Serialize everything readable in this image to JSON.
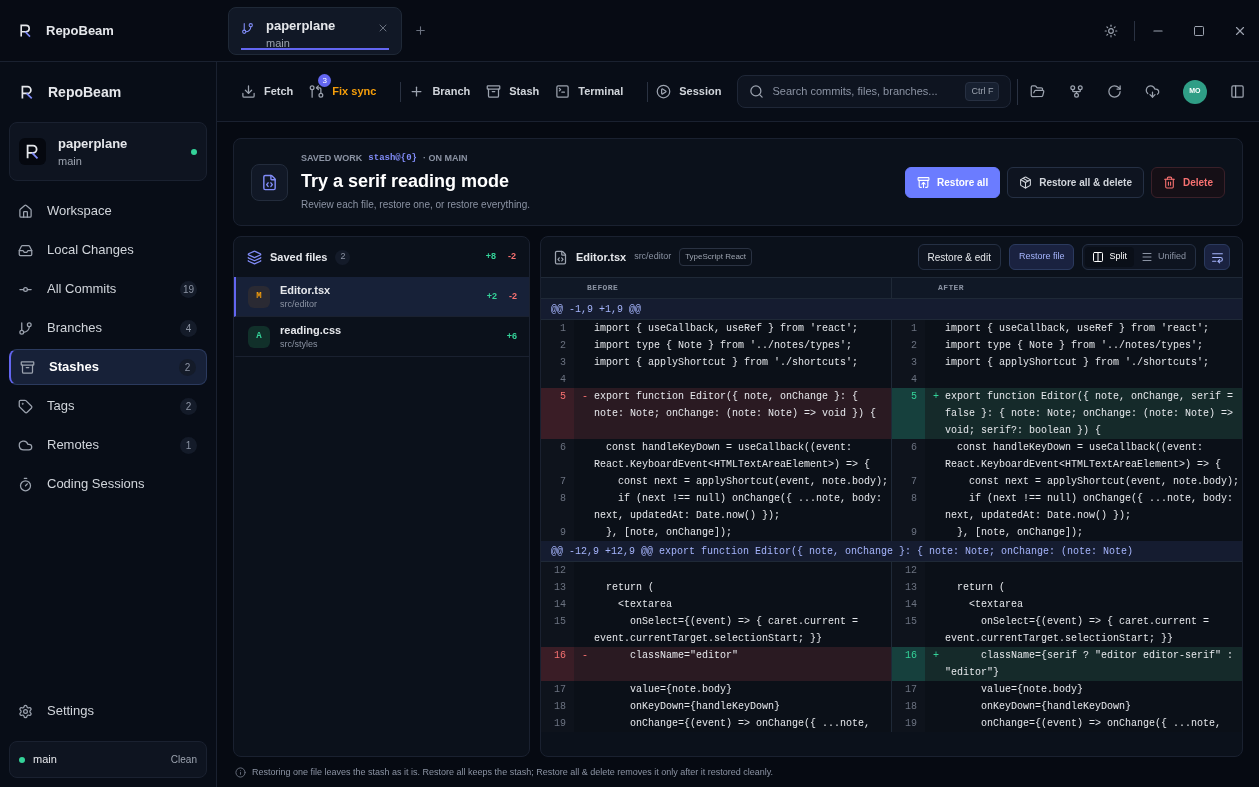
{
  "app": {
    "name": "RepoBeam"
  },
  "tabs": [
    {
      "title": "paperplane",
      "subtitle": "main",
      "selected": true
    }
  ],
  "sidebar": {
    "brand": "RepoBeam",
    "repo": {
      "name": "paperplane",
      "branch": "main",
      "online": true
    },
    "items": [
      {
        "label": "Workspace",
        "selected": false
      },
      {
        "label": "Local Changes",
        "selected": false
      },
      {
        "label": "All Commits",
        "count": "19",
        "selected": false
      },
      {
        "label": "Branches",
        "count": "4",
        "selected": false
      },
      {
        "label": "Stashes",
        "count": "2",
        "selected": true
      },
      {
        "label": "Tags",
        "count": "2",
        "selected": false
      },
      {
        "label": "Remotes",
        "count": "1",
        "selected": false
      },
      {
        "label": "Coding Sessions",
        "selected": false
      }
    ],
    "settings": "Settings",
    "status": {
      "branch": "main",
      "state": "Clean"
    }
  },
  "toolbar": {
    "actions": [
      {
        "kind": "fetch",
        "label": "Fetch",
        "warning": false
      },
      {
        "kind": "sync",
        "label": "Fix sync",
        "badge": "3",
        "warning": true
      },
      {
        "kind": "divider"
      },
      {
        "kind": "branch",
        "label": "Branch",
        "warning": false
      },
      {
        "kind": "stash",
        "label": "Stash",
        "warning": false
      },
      {
        "kind": "terminal",
        "label": "Terminal",
        "warning": false
      },
      {
        "kind": "divider"
      },
      {
        "kind": "session",
        "label": "Session",
        "warning": false
      }
    ],
    "search": {
      "placeholder": "Search commits, files, branches...",
      "shortcut": "Ctrl F"
    },
    "avatar": "MO"
  },
  "stash": {
    "eyebrow": "SAVED WORK",
    "ref": "stash@{0}",
    "on": "· ON MAIN",
    "title": "Try a serif reading mode",
    "subtitle": "Review each file, restore one, or restore everything.",
    "buttons": [
      {
        "kind": "primary",
        "label": "Restore all"
      },
      {
        "kind": "secondary",
        "label": "Restore all & delete"
      },
      {
        "kind": "danger",
        "label": "Delete"
      }
    ]
  },
  "files": {
    "title": "Saved files",
    "count": "2",
    "added": "+8",
    "removed": "-2",
    "items": [
      {
        "status": "M",
        "name": "Editor.tsx",
        "path": "src/editor",
        "added": "+2",
        "removed": "-2",
        "selected": true
      },
      {
        "status": "A",
        "name": "reading.css",
        "path": "src/styles",
        "added": "+6",
        "selected": false
      }
    ]
  },
  "diff": {
    "file": "Editor.tsx",
    "path": "src/editor",
    "language": "TypeScript React",
    "restore_edit": "Restore & edit",
    "restore_file": "Restore file",
    "views": [
      {
        "label": "Split",
        "selected": true
      },
      {
        "label": "Unified",
        "selected": false
      }
    ],
    "before": "BEFORE",
    "after": "AFTER",
    "hunks": [
      {
        "header": "@@ -1,9 +1,9 @@",
        "rows": [
          {
            "left": {
              "n": "1",
              "text": "import { useCallback, useRef } from 'react';"
            },
            "right": {
              "n": "1",
              "text": "import { useCallback, useRef } from 'react';"
            }
          },
          {
            "left": {
              "n": "2",
              "text": "import type { Note } from '../notes/types';"
            },
            "right": {
              "n": "2",
              "text": "import type { Note } from '../notes/types';"
            }
          },
          {
            "left": {
              "n": "3",
              "text": "import { applyShortcut } from './shortcuts';"
            },
            "right": {
              "n": "3",
              "text": "import { applyShortcut } from './shortcuts';"
            }
          },
          {
            "left": {
              "n": "4"
            },
            "right": {
              "n": "4"
            }
          },
          {
            "left": {
              "n": "5",
              "kind": "del",
              "sign": "-",
              "text": "export function Editor({ note, onChange }: { note: Note; onChange: (note: Note) => void }) {"
            },
            "right": {
              "n": "5",
              "kind": "add",
              "sign": "+",
              "text": "export function Editor({ note, onChange, serif = false }: { note: Note; onChange: (note: Note) => void; serif?: boolean }) {"
            }
          },
          {
            "left": {
              "n": "6",
              "text": "  const handleKeyDown = useCallback((event: React.KeyboardEvent<HTMLTextAreaElement>) => {"
            },
            "right": {
              "n": "6",
              "text": "  const handleKeyDown = useCallback((event: React.KeyboardEvent<HTMLTextAreaElement>) => {"
            }
          },
          {
            "left": {
              "n": "7",
              "text": "    const next = applyShortcut(event, note.body);"
            },
            "right": {
              "n": "7",
              "text": "    const next = applyShortcut(event, note.body);"
            }
          },
          {
            "left": {
              "n": "8",
              "text": "    if (next !== null) onChange({ ...note, body: next, updatedAt: Date.now() });"
            },
            "right": {
              "n": "8",
              "text": "    if (next !== null) onChange({ ...note, body: next, updatedAt: Date.now() });"
            }
          },
          {
            "left": {
              "n": "9",
              "text": "  }, [note, onChange]);"
            },
            "right": {
              "n": "9",
              "text": "  }, [note, onChange]);"
            }
          }
        ]
      },
      {
        "header": "@@ -12,9 +12,9 @@ export function Editor({ note, onChange }: { note: Note; onChange: (note: Note)",
        "rows": [
          {
            "left": {
              "n": "12"
            },
            "right": {
              "n": "12"
            }
          },
          {
            "left": {
              "n": "13",
              "text": "  return ("
            },
            "right": {
              "n": "13",
              "text": "  return ("
            }
          },
          {
            "left": {
              "n": "14",
              "text": "    <textarea"
            },
            "right": {
              "n": "14",
              "text": "    <textarea"
            }
          },
          {
            "left": {
              "n": "15",
              "text": "      onSelect={(event) => { caret.current = event.currentTarget.selectionStart; }}"
            },
            "right": {
              "n": "15",
              "text": "      onSelect={(event) => { caret.current = event.currentTarget.selectionStart; }}"
            }
          },
          {
            "left": {
              "n": "16",
              "kind": "del",
              "sign": "-",
              "text": "      className=\"editor\""
            },
            "right": {
              "n": "16",
              "kind": "add",
              "sign": "+",
              "text": "      className={serif ? \"editor editor-serif\" : \"editor\"}"
            }
          },
          {
            "left": {
              "n": "17",
              "text": "      value={note.body}"
            },
            "right": {
              "n": "17",
              "text": "      value={note.body}"
            }
          },
          {
            "left": {
              "n": "18",
              "text": "      onKeyDown={handleKeyDown}"
            },
            "right": {
              "n": "18",
              "text": "      onKeyDown={handleKeyDown}"
            }
          },
          {
            "left": {
              "n": "19",
              "text": "      onChange={(event) => onChange({ ...note,"
            },
            "right": {
              "n": "19",
              "text": "      onChange={(event) => onChange({ ...note,"
            }
          }
        ]
      }
    ]
  },
  "footer_note": "Restoring one file leaves the stash as it is. Restore all keeps the stash; Restore all & delete removes it only after it restored cleanly."
}
